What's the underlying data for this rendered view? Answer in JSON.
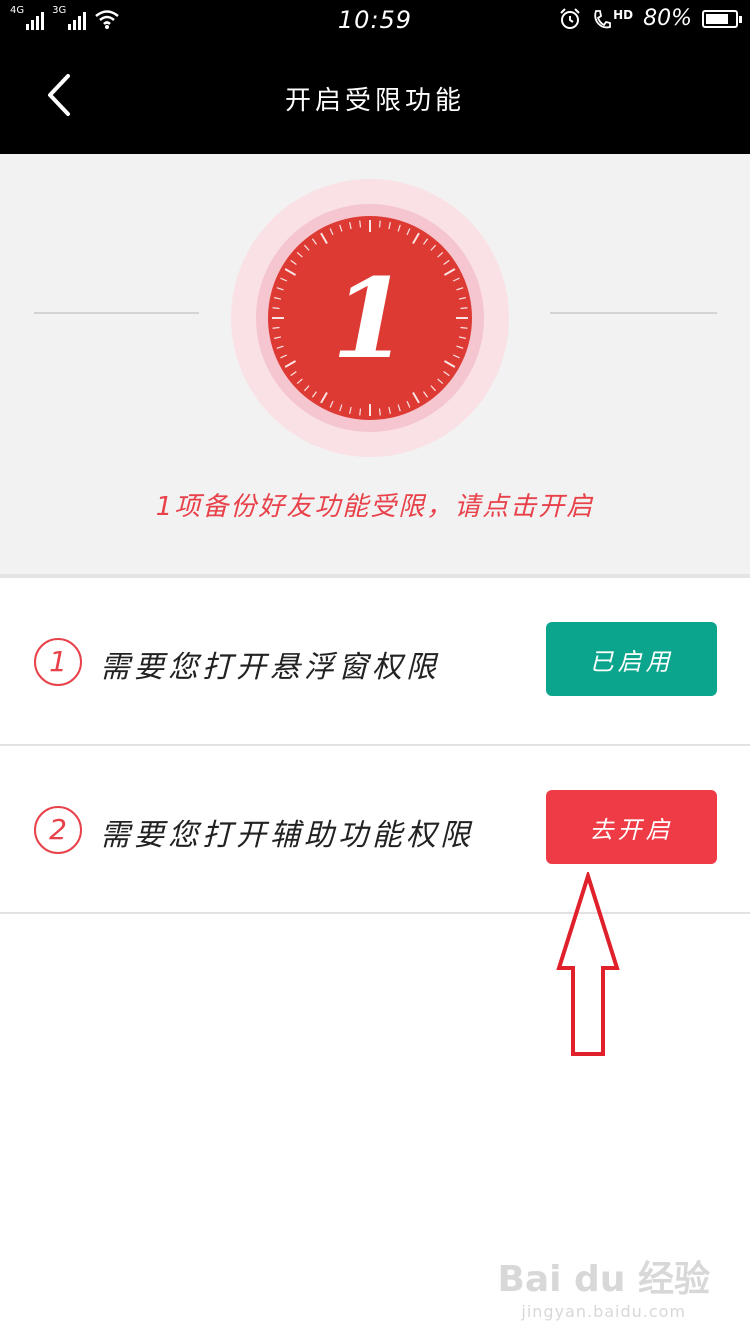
{
  "status_bar": {
    "network1": "4G",
    "network2": "3G",
    "time": "10:59",
    "hd": "HD",
    "battery": "80%",
    "battery_level": 0.8
  },
  "header": {
    "title": "开启受限功能"
  },
  "hero": {
    "count": "1",
    "message": "1项备份好友功能受限，请点击开启",
    "accent": "#e8414a"
  },
  "permissions": [
    {
      "number": "1",
      "label": "需要您打开悬浮窗权限",
      "button": "已启用",
      "color": "#0ba58d"
    },
    {
      "number": "2",
      "label": "需要您打开辅助功能权限",
      "button": "去开启",
      "color": "#ef3b45"
    }
  ],
  "watermark": {
    "logo": "Bai du 经验",
    "sub": "jingyan.baidu.com"
  }
}
